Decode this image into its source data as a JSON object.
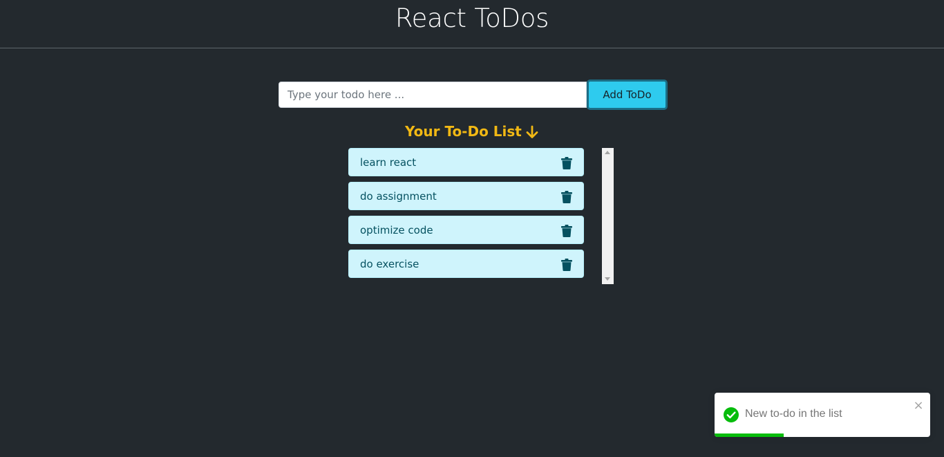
{
  "header": {
    "title": "React ToDos"
  },
  "form": {
    "input_placeholder": "Type your todo here ...",
    "input_value": "",
    "add_button_label": "Add ToDo"
  },
  "list": {
    "heading": "Your To-Do List",
    "heading_icon": "arrow-down-icon",
    "items": [
      {
        "text": "learn react",
        "icon": "trash-icon"
      },
      {
        "text": "do assignment",
        "icon": "trash-icon"
      },
      {
        "text": "optimize code",
        "icon": "trash-icon"
      },
      {
        "text": "do exercise",
        "icon": "trash-icon"
      }
    ]
  },
  "toast": {
    "message": "New to-do in the list",
    "icon": "check-circle-icon",
    "close_icon": "close-icon",
    "progress": 0.32
  },
  "colors": {
    "background": "#23292e",
    "heading_accent": "#f1b814",
    "button": "#2ecbee",
    "item_background": "#cff4fc",
    "item_text": "#055160",
    "success": "#07bc0c"
  }
}
